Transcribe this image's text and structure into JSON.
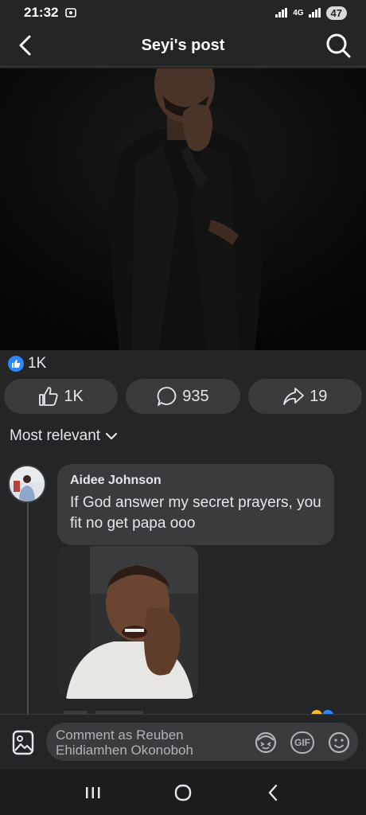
{
  "status": {
    "time": "21:32",
    "network": "4G",
    "battery": "47"
  },
  "header": {
    "title": "Seyi's post"
  },
  "post": {
    "reaction_count": "1K",
    "actions": [
      {
        "label": "1K",
        "icon": "thumbs-up-icon"
      },
      {
        "label": "935",
        "icon": "comment-icon"
      },
      {
        "label": "19",
        "icon": "share-icon"
      }
    ]
  },
  "comments": {
    "sort_label": "Most relevant",
    "items": [
      {
        "author": "Aidee Johnson",
        "text": "If God answer my secret prayers, you fit no get papa ooo"
      }
    ]
  },
  "composer": {
    "placeholder": "Comment as Reuben Ehidiamhen Okonoboh",
    "gif_label": "GIF"
  },
  "colors": {
    "background": "#242526",
    "surface": "#3a3b3c",
    "accent": "#2d88ff",
    "text": "#e4e6eb"
  }
}
